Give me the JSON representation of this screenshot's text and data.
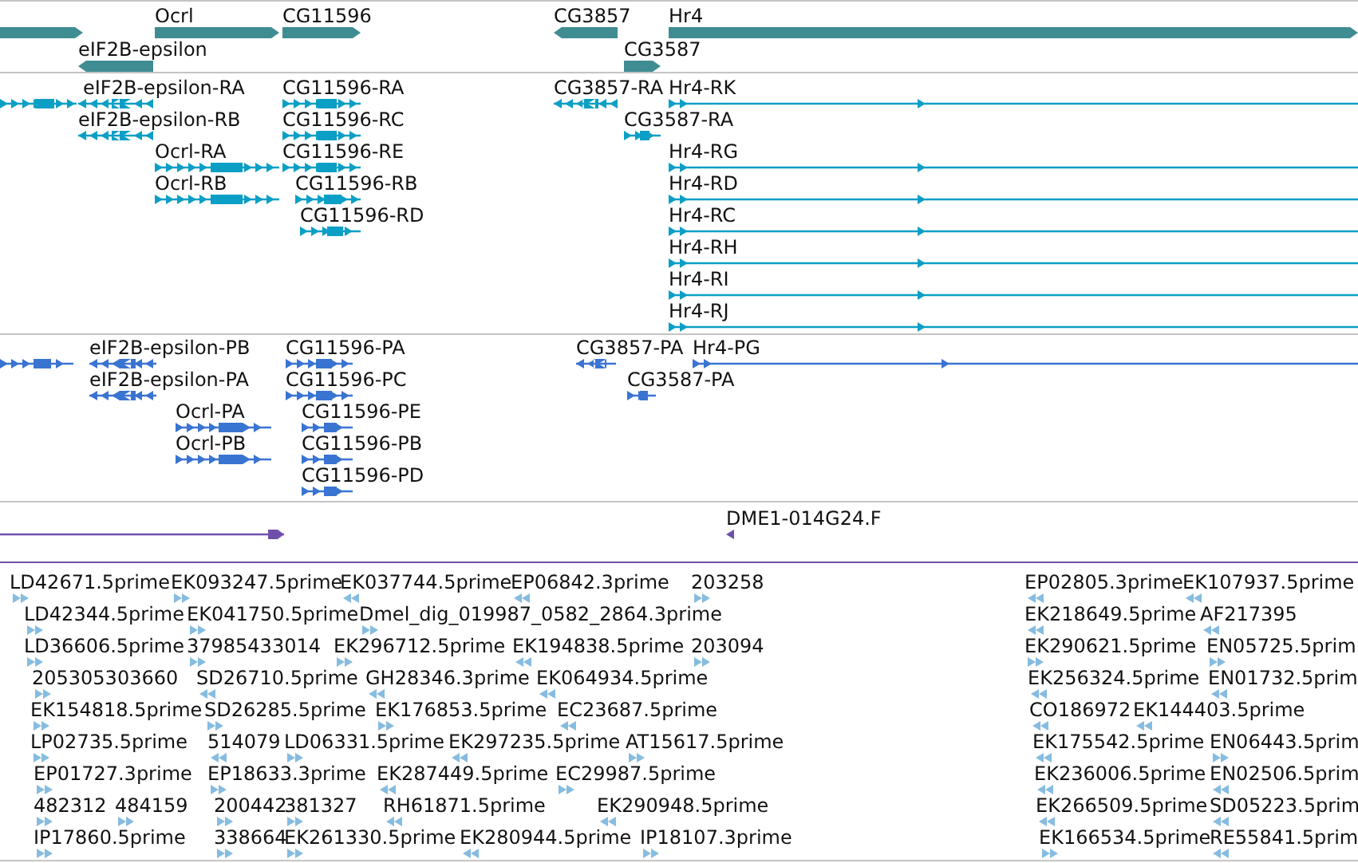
{
  "tracks": [
    {
      "kind": "gene",
      "features": [
        {
          "reverse": false
        },
        {
          "label": "Ocrl",
          "reverse": false
        },
        {
          "label": "CG11596",
          "reverse": false
        },
        {
          "label": "CG3857",
          "reverse": true
        },
        {
          "label": "Hr4",
          "reverse": false
        },
        {
          "label": "eIF2B-epsilon",
          "reverse": true
        },
        {
          "label": "CG3587",
          "reverse": false
        }
      ]
    },
    {
      "kind": "transcript",
      "features": [
        {
          "reverse": false
        },
        {
          "label": "eIF2B-epsilon-RA",
          "reverse": true
        },
        {
          "label": "CG11596-RA",
          "reverse": false
        },
        {
          "label": "CG3857-RA",
          "reverse": true
        },
        {
          "label": "Hr4-RK",
          "reverse": false
        },
        {
          "label": "eIF2B-epsilon-RB",
          "reverse": true
        },
        {
          "label": "CG11596-RC",
          "reverse": false
        },
        {
          "label": "CG3587-RA",
          "reverse": false
        },
        {
          "label": "Ocrl-RA",
          "reverse": false
        },
        {
          "label": "CG11596-RE",
          "reverse": false
        },
        {
          "label": "Hr4-RG",
          "reverse": false
        },
        {
          "label": "Ocrl-RB",
          "reverse": false
        },
        {
          "label": "CG11596-RB",
          "reverse": false
        },
        {
          "label": "Hr4-RD",
          "reverse": false
        },
        {
          "label": "CG11596-RD",
          "reverse": false
        },
        {
          "label": "Hr4-RC",
          "reverse": false
        },
        {
          "label": "Hr4-RH",
          "reverse": false
        },
        {
          "label": "Hr4-RI",
          "reverse": false
        },
        {
          "label": "Hr4-RJ",
          "reverse": false
        }
      ]
    },
    {
      "kind": "protein",
      "features": [
        {
          "reverse": false
        },
        {
          "label": "eIF2B-epsilon-PB",
          "reverse": true
        },
        {
          "label": "CG11596-PA",
          "reverse": false
        },
        {
          "label": "CG3857-PA",
          "reverse": true
        },
        {
          "label": "Hr4-PG",
          "reverse": false
        },
        {
          "label": "eIF2B-epsilon-PA",
          "reverse": true
        },
        {
          "label": "CG11596-PC",
          "reverse": false
        },
        {
          "label": "CG3587-PA",
          "reverse": false
        },
        {
          "label": "Ocrl-PA",
          "reverse": false
        },
        {
          "label": "CG11596-PE",
          "reverse": false
        },
        {
          "label": "Ocrl-PB",
          "reverse": false
        },
        {
          "label": "CG11596-PB",
          "reverse": false
        },
        {
          "label": "CG11596-PD",
          "reverse": false
        }
      ]
    },
    {
      "kind": "match",
      "features": [
        {
          "reverse": false
        },
        {
          "label": "DME1-014G24.F",
          "reverse": true
        }
      ]
    },
    {
      "kind": "est",
      "features": [
        {
          "label": "LD42671.5prime",
          "reverse": false
        },
        {
          "label": "EK093247.5prime",
          "reverse": false
        },
        {
          "label": "EK037744.5prime",
          "reverse": true
        },
        {
          "label": "EP06842.3prime",
          "reverse": true
        },
        {
          "label": "203258",
          "reverse": false
        },
        {
          "label": "EP02805.3prime",
          "reverse": true
        },
        {
          "label": "EK107937.5prime",
          "reverse": true
        },
        {
          "label": "LD42344.5prime",
          "reverse": false
        },
        {
          "label": "EK041750.5prime",
          "reverse": false
        },
        {
          "label": "Dmel_dig_019987_0582_2864.3prime",
          "reverse": false
        },
        {
          "label": "EK218649.5prime",
          "reverse": true
        },
        {
          "label": "AF217395",
          "reverse": true
        },
        {
          "label": "LD36606.5prime",
          "reverse": false
        },
        {
          "label": "37985433014",
          "reverse": false
        },
        {
          "label": "EK296712.5prime",
          "reverse": false
        },
        {
          "label": "EK194838.5prime",
          "reverse": true
        },
        {
          "label": "203094",
          "reverse": false
        },
        {
          "label": "EK290621.5prime",
          "reverse": false
        },
        {
          "label": "EN05725.5prim",
          "reverse": false
        },
        {
          "label": "205305303660",
          "reverse": false
        },
        {
          "label": "SD26710.5prime",
          "reverse": true
        },
        {
          "label": "GH28346.3prime",
          "reverse": true
        },
        {
          "label": "EK064934.5prime",
          "reverse": true
        },
        {
          "label": "EK256324.5prime",
          "reverse": true
        },
        {
          "label": "EN01732.5prim",
          "reverse": true
        },
        {
          "label": "EK154818.5prime",
          "reverse": false
        },
        {
          "label": "SD26285.5prime",
          "reverse": false
        },
        {
          "label": "EK176853.5prime",
          "reverse": false
        },
        {
          "label": "EC23687.5prime",
          "reverse": true
        },
        {
          "label": "CO186972",
          "reverse": true
        },
        {
          "label": "EK144403.5prime",
          "reverse": true
        },
        {
          "label": "LP02735.5prime",
          "reverse": false
        },
        {
          "label": "514079",
          "reverse": true
        },
        {
          "label": "LD06331.5prime",
          "reverse": false
        },
        {
          "label": "EK297235.5prime",
          "reverse": true
        },
        {
          "label": "AT15617.5prime",
          "reverse": false
        },
        {
          "label": "EK175542.5prime",
          "reverse": true
        },
        {
          "label": "EN06443.5prim",
          "reverse": false
        },
        {
          "label": "EP01727.3prime",
          "reverse": false
        },
        {
          "label": "EP18633.3prime",
          "reverse": false
        },
        {
          "label": "EK287449.5prime",
          "reverse": true
        },
        {
          "label": "EC29987.5prime",
          "reverse": false
        },
        {
          "label": "EK236006.5prime",
          "reverse": true
        },
        {
          "label": "EN02506.5prim",
          "reverse": true
        },
        {
          "label": "482312",
          "reverse": false
        },
        {
          "label": "484159",
          "reverse": false
        },
        {
          "label": "200442",
          "reverse": false
        },
        {
          "label": "381327",
          "reverse": false
        },
        {
          "label": "RH61871.5prime",
          "reverse": true
        },
        {
          "label": "EK290948.5prime",
          "reverse": true
        },
        {
          "label": "EK266509.5prime",
          "reverse": true
        },
        {
          "label": "SD05223.5prim",
          "reverse": true
        },
        {
          "label": "IP17860.5prime",
          "reverse": false
        },
        {
          "label": "338664",
          "reverse": false
        },
        {
          "label": "EK261330.5prime",
          "reverse": false
        },
        {
          "label": "EK280944.5prime",
          "reverse": true
        },
        {
          "label": "IP18107.3prime",
          "reverse": false
        },
        {
          "label": "EK166534.5prime",
          "reverse": false
        },
        {
          "label": "RE55841.5prim",
          "reverse": true
        }
      ]
    }
  ]
}
